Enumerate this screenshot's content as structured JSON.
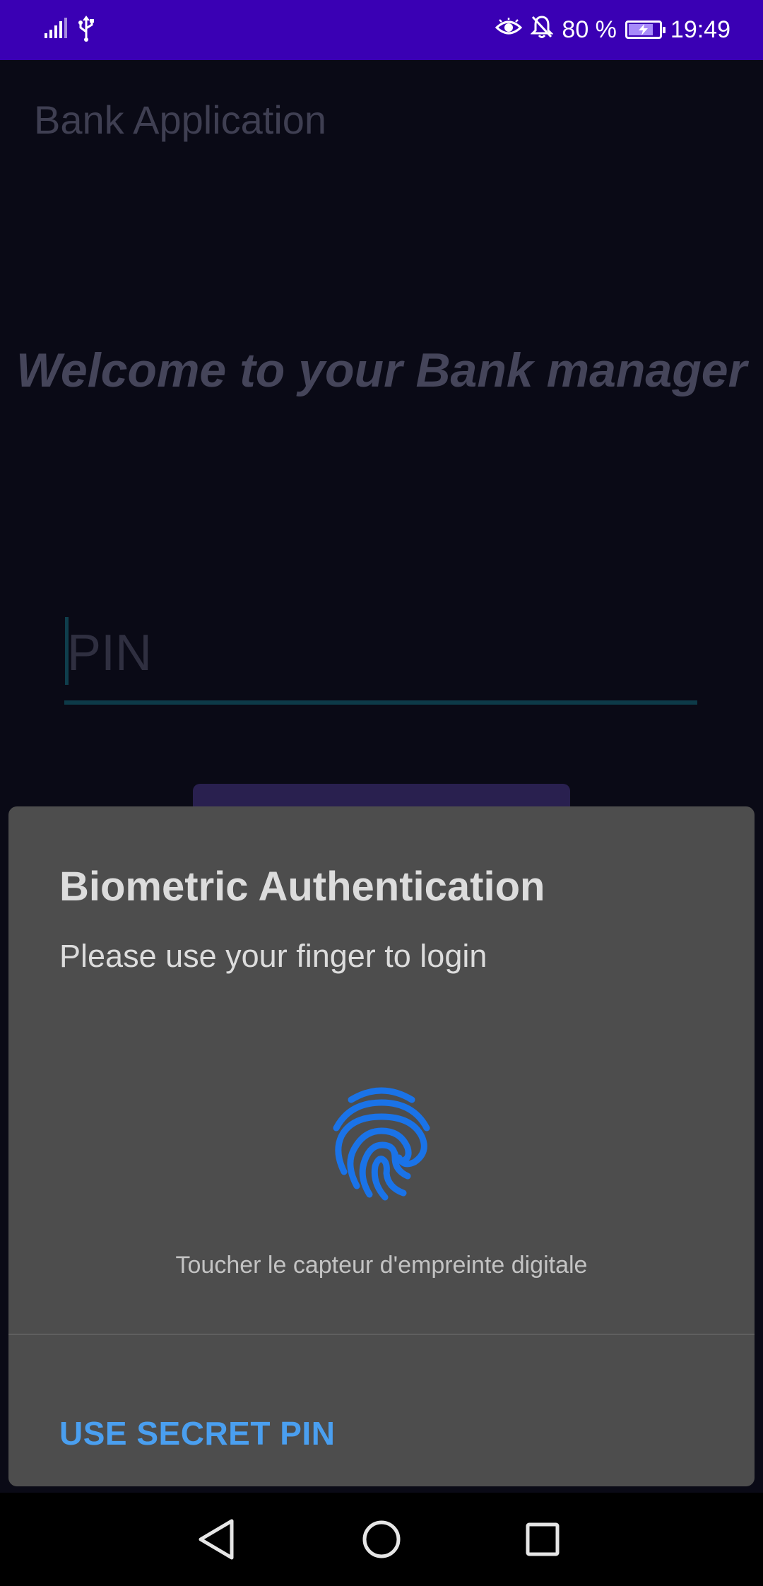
{
  "status_bar": {
    "battery_text": "80 %",
    "battery_level": 80,
    "time": "19:49",
    "icons": [
      "signal-icon",
      "usb-icon",
      "eye-comfort-icon",
      "bell-off-icon",
      "battery-charging-icon"
    ],
    "background_color": "#3a00b4"
  },
  "app": {
    "title": "Bank Application",
    "welcome_text": "Welcome to your Bank manager",
    "pin_placeholder": "PIN"
  },
  "dialog": {
    "title": "Biometric Authentication",
    "subtitle": "Please use your finger to login",
    "icon": "fingerprint-icon",
    "hint": "Toucher le capteur d'empreinte digitale",
    "negative_button": "USE SECRET PIN",
    "accent_color": "#4a9ff0",
    "fingerprint_color": "#1a73e8"
  },
  "nav_bar": {
    "buttons": [
      "back-icon",
      "home-icon",
      "recents-icon"
    ]
  }
}
